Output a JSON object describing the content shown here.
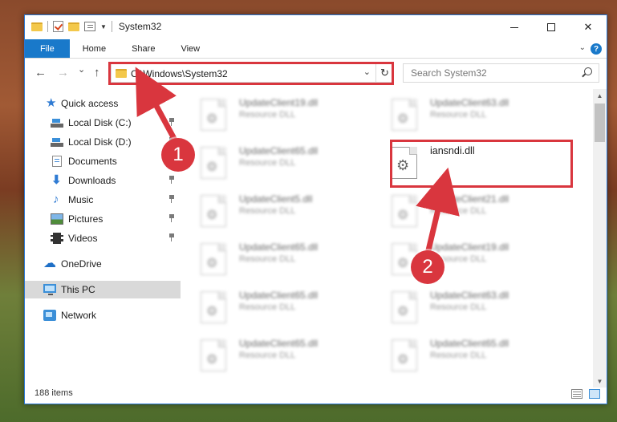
{
  "window": {
    "title": "System32",
    "controls": {
      "minimize": "—",
      "maximize": "☐",
      "close": "✕"
    }
  },
  "ribbon": {
    "tabs": [
      "File",
      "Home",
      "Share",
      "View"
    ],
    "help": "?"
  },
  "nav": {
    "back": "←",
    "forward": "→",
    "recent": "⌄",
    "up": "↑",
    "address": "C:\\Windows\\System32",
    "address_dropdown": "⌄",
    "refresh": "↻",
    "search_placeholder": "Search System32"
  },
  "sidebar": {
    "items": [
      {
        "label": "Quick access",
        "icon": "star-icon",
        "pinned": false,
        "indent": 1
      },
      {
        "label": "Local Disk (C:)",
        "icon": "drive-icon",
        "pinned": true,
        "indent": 2
      },
      {
        "label": "Local Disk (D:)",
        "icon": "drive-icon",
        "pinned": true,
        "indent": 2
      },
      {
        "label": "Documents",
        "icon": "documents-icon",
        "pinned": true,
        "indent": 2
      },
      {
        "label": "Downloads",
        "icon": "downloads-icon",
        "pinned": true,
        "indent": 2
      },
      {
        "label": "Music",
        "icon": "music-icon",
        "pinned": true,
        "indent": 2
      },
      {
        "label": "Pictures",
        "icon": "pictures-icon",
        "pinned": true,
        "indent": 2
      },
      {
        "label": "Videos",
        "icon": "videos-icon",
        "pinned": true,
        "indent": 2
      },
      {
        "label": "OneDrive",
        "icon": "onedrive-icon",
        "pinned": false,
        "indent": 1
      },
      {
        "label": "This PC",
        "icon": "this-pc-icon",
        "pinned": false,
        "indent": 1,
        "selected": true
      },
      {
        "label": "Network",
        "icon": "network-icon",
        "pinned": false,
        "indent": 1
      }
    ]
  },
  "files": [
    {
      "name": "UpdateClient19.dll",
      "desc": "Resource DLL"
    },
    {
      "name": "UpdateClient63.dll",
      "desc": "Resource DLL"
    },
    {
      "name": "UpdateClient65.dll",
      "desc": "Resource DLL"
    },
    {
      "name": "iansndi.dll",
      "desc": "",
      "highlighted": true
    },
    {
      "name": "UpdateClient5.dll",
      "desc": "Resource DLL"
    },
    {
      "name": "UpdateClient21.dll",
      "desc": "Resource DLL"
    },
    {
      "name": "UpdateClient65.dll",
      "desc": "Resource DLL"
    },
    {
      "name": "UpdateClient19.dll",
      "desc": "Resource DLL"
    },
    {
      "name": "UpdateClient65.dll",
      "desc": "Resource DLL"
    },
    {
      "name": "UpdateClient63.dll",
      "desc": "Resource DLL"
    },
    {
      "name": "UpdateClient65.dll",
      "desc": "Resource DLL"
    },
    {
      "name": "UpdateClient65.dll",
      "desc": "Resource DLL"
    }
  ],
  "status": {
    "item_count": "188 items"
  },
  "annotations": {
    "callout_1": "1",
    "callout_2": "2",
    "color": "#d9363e"
  },
  "colors": {
    "accent": "#1979ca",
    "selected_bg": "#d9d9d9"
  }
}
